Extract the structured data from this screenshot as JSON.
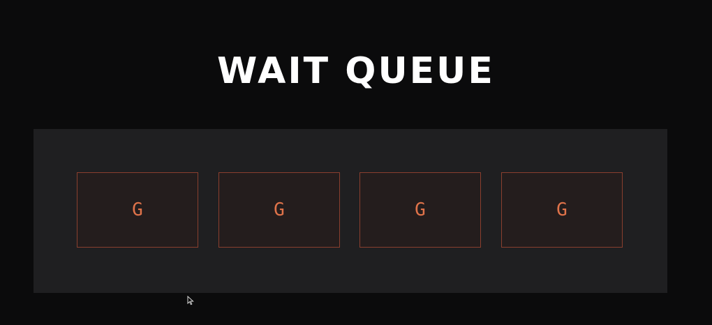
{
  "title": "WAIT QUEUE",
  "queue": {
    "items": [
      {
        "label": "G"
      },
      {
        "label": "G"
      },
      {
        "label": "G"
      },
      {
        "label": "G"
      }
    ]
  },
  "colors": {
    "background": "#0b0b0c",
    "panel": "#1f1f21",
    "slot_border": "#8a3f2e",
    "slot_fill": "#241d1d",
    "slot_text": "#e0734a",
    "title": "#ffffff"
  }
}
